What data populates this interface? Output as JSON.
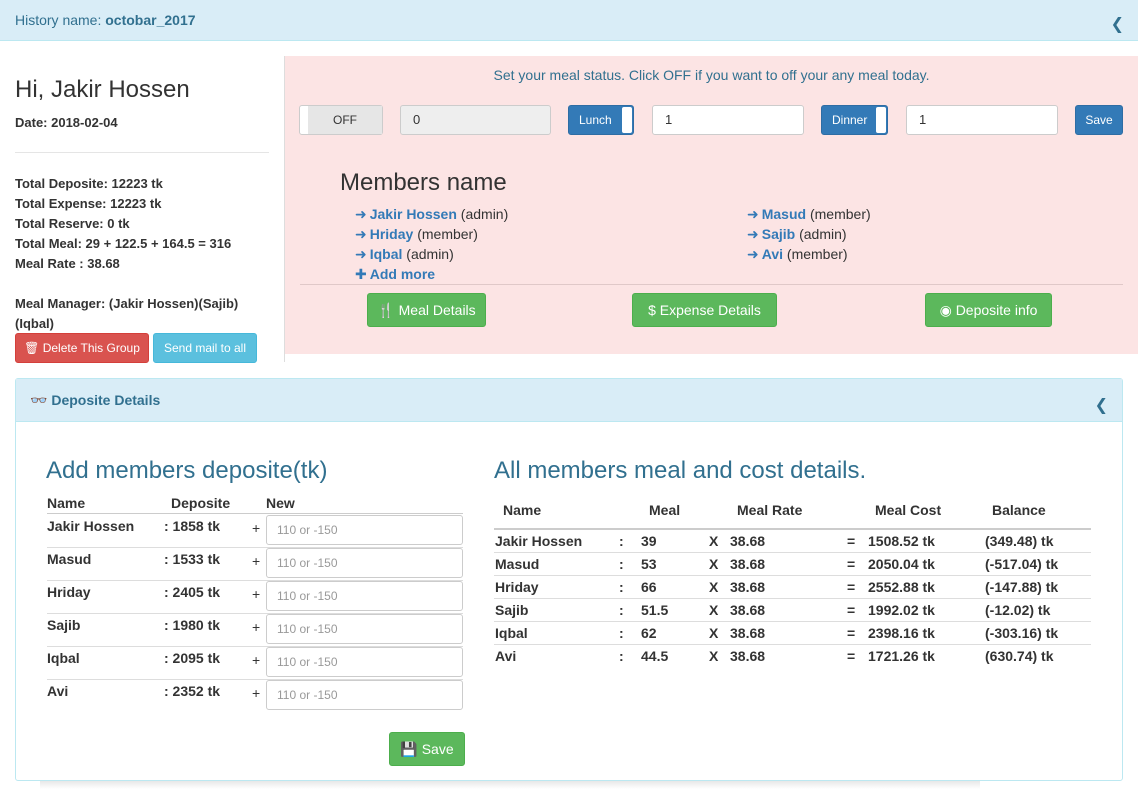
{
  "topbar": {
    "label": "History name:",
    "name": "octobar_2017"
  },
  "user": {
    "greeting": "Hi, Jakir Hossen",
    "date": "Date: 2018-02-04",
    "total_deposite": "Total Deposite: 12223 tk",
    "total_expense": "Total Expense: 12223 tk",
    "total_reserve": "Total Reserve: 0 tk",
    "total_meal": "Total Meal: 29 + 122.5 + 164.5 = 316",
    "meal_rate": "Meal Rate : 38.68",
    "manager_line1": "Meal Manager: (Jakir Hossen)(Sajib)",
    "manager_line2": "(Iqbal)",
    "delete_btn": "Delete This Group",
    "mail_btn": "Send mail to all"
  },
  "status": {
    "notice": "Set your meal status. Click OFF if you want to off your any meal today.",
    "off_label": "OFF",
    "off_value": "0",
    "lunch_label": "Lunch",
    "lunch_value": "1",
    "dinner_label": "Dinner",
    "dinner_value": "1",
    "save_label": "Save"
  },
  "members": {
    "title": "Members name",
    "left": [
      {
        "name": "Jakir Hossen",
        "role": "(admin)"
      },
      {
        "name": "Hriday",
        "role": "(member)"
      },
      {
        "name": "Iqbal",
        "role": "(admin)"
      }
    ],
    "right": [
      {
        "name": "Masud",
        "role": "(member)"
      },
      {
        "name": "Sajib",
        "role": "(admin)"
      },
      {
        "name": "Avi",
        "role": "(member)"
      }
    ],
    "add_more": "Add more",
    "meal_details_btn": "Meal Details",
    "expense_details_btn": "Expense Details",
    "deposite_info_btn": "Deposite info"
  },
  "deposite_panel": {
    "title": "Deposite Details",
    "add_title": "Add members deposite(tk)",
    "headers": [
      "Name",
      "Deposite",
      "New"
    ],
    "rows": [
      {
        "name": "Jakir Hossen",
        "deposite": ": 1858 tk",
        "plus": "+",
        "placeholder": "110 or -150"
      },
      {
        "name": "Masud",
        "deposite": ": 1533 tk",
        "plus": "+",
        "placeholder": "110 or -150"
      },
      {
        "name": "Hriday",
        "deposite": ": 2405 tk",
        "plus": "+",
        "placeholder": "110 or -150"
      },
      {
        "name": "Sajib",
        "deposite": ": 1980 tk",
        "plus": "+",
        "placeholder": "110 or -150"
      },
      {
        "name": "Iqbal",
        "deposite": ": 2095 tk",
        "plus": "+",
        "placeholder": "110 or -150"
      },
      {
        "name": "Avi",
        "deposite": ": 2352 tk",
        "plus": "+",
        "placeholder": "110 or -150"
      }
    ],
    "save_label": "Save",
    "cost_title": "All members meal and cost details.",
    "cost_headers": [
      "Name",
      "Meal",
      "Meal Rate",
      "Meal Cost",
      "Balance"
    ],
    "cost_rows": [
      {
        "name": "Jakir Hossen",
        "colon": ":",
        "meal": "39",
        "x": "X",
        "rate": "38.68",
        "eq": "=",
        "cost": "1508.52 tk",
        "balance": "(349.48) tk"
      },
      {
        "name": "Masud",
        "colon": ":",
        "meal": "53",
        "x": "X",
        "rate": "38.68",
        "eq": "=",
        "cost": "2050.04 tk",
        "balance": "(-517.04) tk"
      },
      {
        "name": "Hriday",
        "colon": ":",
        "meal": "66",
        "x": "X",
        "rate": "38.68",
        "eq": "=",
        "cost": "2552.88 tk",
        "balance": "(-147.88) tk"
      },
      {
        "name": "Sajib",
        "colon": ":",
        "meal": "51.5",
        "x": "X",
        "rate": "38.68",
        "eq": "=",
        "cost": "1992.02 tk",
        "balance": "(-12.02) tk"
      },
      {
        "name": "Iqbal",
        "colon": ":",
        "meal": "62",
        "x": "X",
        "rate": "38.68",
        "eq": "=",
        "cost": "2398.16 tk",
        "balance": "(-303.16) tk"
      },
      {
        "name": "Avi",
        "colon": ":",
        "meal": "44.5",
        "x": "X",
        "rate": "38.68",
        "eq": "=",
        "cost": "1721.26 tk",
        "balance": "(630.74) tk"
      }
    ]
  },
  "icons": {
    "chevron": "chevron-left-icon",
    "trash": "trash-icon",
    "arrow": "arrow-right-icon",
    "plus": "plus-icon",
    "cutlery": "cutlery-icon",
    "dollar": "dollar-icon",
    "piggy": "piggy-bank-icon",
    "glasses": "glasses-icon",
    "save": "save-icon"
  },
  "colors": {
    "primary": "#337ab7",
    "success": "#5cb85c",
    "danger": "#d9534f",
    "info": "#5bc0de",
    "panel_heading": "#d9edf7",
    "status_bg": "#fce4e4"
  }
}
